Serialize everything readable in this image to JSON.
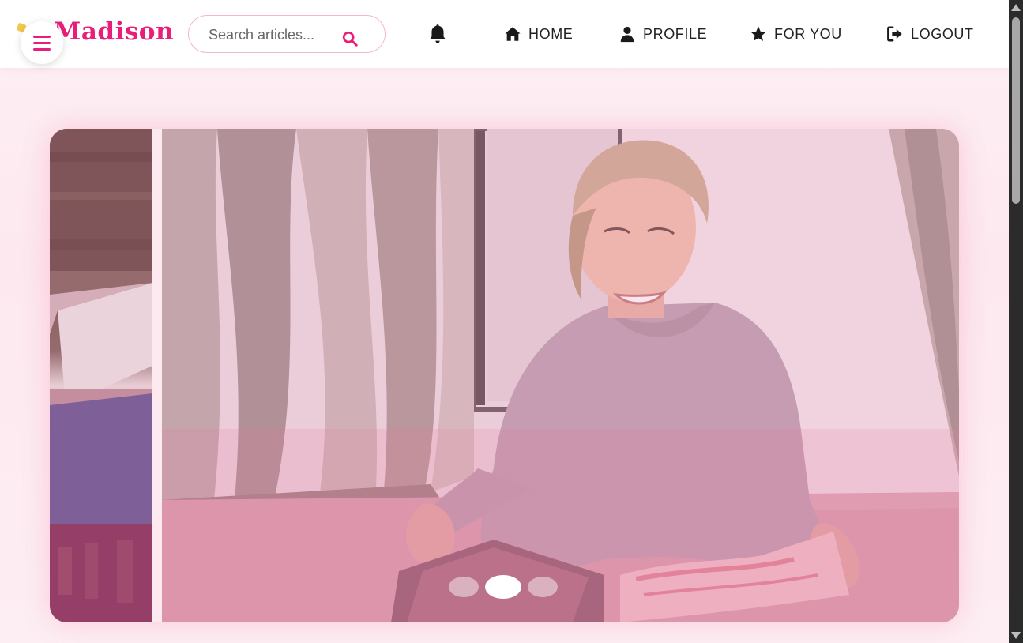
{
  "brand": {
    "name": "Madison",
    "accent_color": "#e91e7a"
  },
  "search": {
    "placeholder": "Search articles..."
  },
  "nav": {
    "items": [
      {
        "label": "HOME",
        "icon": "home-icon"
      },
      {
        "label": "PROFILE",
        "icon": "user-icon"
      },
      {
        "label": "FOR YOU",
        "icon": "star-icon"
      },
      {
        "label": "LOGOUT",
        "icon": "logout-icon"
      }
    ],
    "notification_icon": "bell-icon",
    "menu_icon": "hamburger-icon"
  },
  "carousel": {
    "slides": [
      {
        "name": "books-on-table"
      },
      {
        "name": "woman-reading-magazine"
      },
      {
        "name": "next-slide"
      }
    ],
    "active_index": 1,
    "overlay_color": "#e8a0bd"
  }
}
